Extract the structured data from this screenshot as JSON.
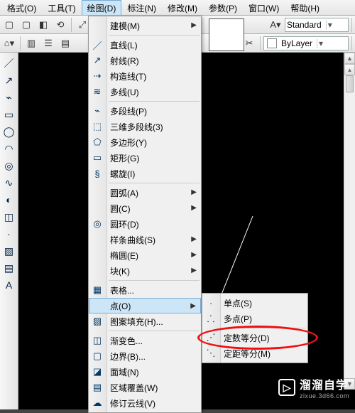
{
  "menubar": {
    "items": [
      {
        "label": "格式(O)"
      },
      {
        "label": "工具(T)"
      },
      {
        "label": "绘图(D)"
      },
      {
        "label": "标注(N)"
      },
      {
        "label": "修改(M)"
      },
      {
        "label": "参数(P)"
      },
      {
        "label": "窗口(W)"
      },
      {
        "label": "帮助(H)"
      }
    ],
    "open_index": 2
  },
  "toolbar_top1": {
    "standard_label": "Standard"
  },
  "toolbar_top2": {
    "layer_combo": "ByLayer"
  },
  "draw_menu": {
    "sections": [
      {
        "items": [
          {
            "icon": "",
            "label": "建模(M)",
            "sub": true
          }
        ]
      },
      {
        "items": [
          {
            "icon": "／",
            "label": "直线(L)"
          },
          {
            "icon": "↗",
            "label": "射线(R)"
          },
          {
            "icon": "⇢",
            "label": "构造线(T)"
          },
          {
            "icon": "≋",
            "label": "多线(U)"
          }
        ]
      },
      {
        "items": [
          {
            "icon": "⌁",
            "label": "多段线(P)"
          },
          {
            "icon": "⬚",
            "label": "三维多段线(3)"
          },
          {
            "icon": "⬠",
            "label": "多边形(Y)"
          },
          {
            "icon": "▭",
            "label": "矩形(G)"
          },
          {
            "icon": "§",
            "label": "螺旋(I)"
          }
        ]
      },
      {
        "items": [
          {
            "icon": "",
            "label": "圆弧(A)",
            "sub": true
          },
          {
            "icon": "",
            "label": "圆(C)",
            "sub": true
          },
          {
            "icon": "◎",
            "label": "圆环(D)"
          },
          {
            "icon": "",
            "label": "样条曲线(S)",
            "sub": true
          },
          {
            "icon": "",
            "label": "椭圆(E)",
            "sub": true
          },
          {
            "icon": "",
            "label": "块(K)",
            "sub": true
          }
        ]
      },
      {
        "items": [
          {
            "icon": "▦",
            "label": "表格..."
          },
          {
            "icon": "",
            "label": "点(O)",
            "sub": true,
            "hover": true
          },
          {
            "icon": "▨",
            "label": "图案填充(H)..."
          }
        ]
      },
      {
        "items": [
          {
            "icon": "◫",
            "label": "渐变色..."
          },
          {
            "icon": "▢",
            "label": "边界(B)..."
          },
          {
            "icon": "◪",
            "label": "面域(N)"
          },
          {
            "icon": "▤",
            "label": "区域覆盖(W)"
          },
          {
            "icon": "☁",
            "label": "修订云线(V)"
          }
        ]
      }
    ]
  },
  "point_submenu": {
    "items": [
      {
        "icon": "·",
        "label": "单点(S)"
      },
      {
        "icon": "⸫",
        "label": "多点(P)"
      }
    ],
    "items2": [
      {
        "icon": "⋰",
        "label": "定数等分(D)",
        "highlighted": true
      },
      {
        "icon": "⋱",
        "label": "定距等分(M)"
      }
    ]
  },
  "left_tools": [
    "／",
    "↗",
    "⌁",
    "▭",
    "◯",
    "◠",
    "◎",
    "∿",
    "◐",
    "◫",
    "·",
    "▨",
    "▤",
    "A"
  ],
  "watermark": {
    "title": "溜溜自学",
    "subtitle": "zixue.3d66.com"
  }
}
